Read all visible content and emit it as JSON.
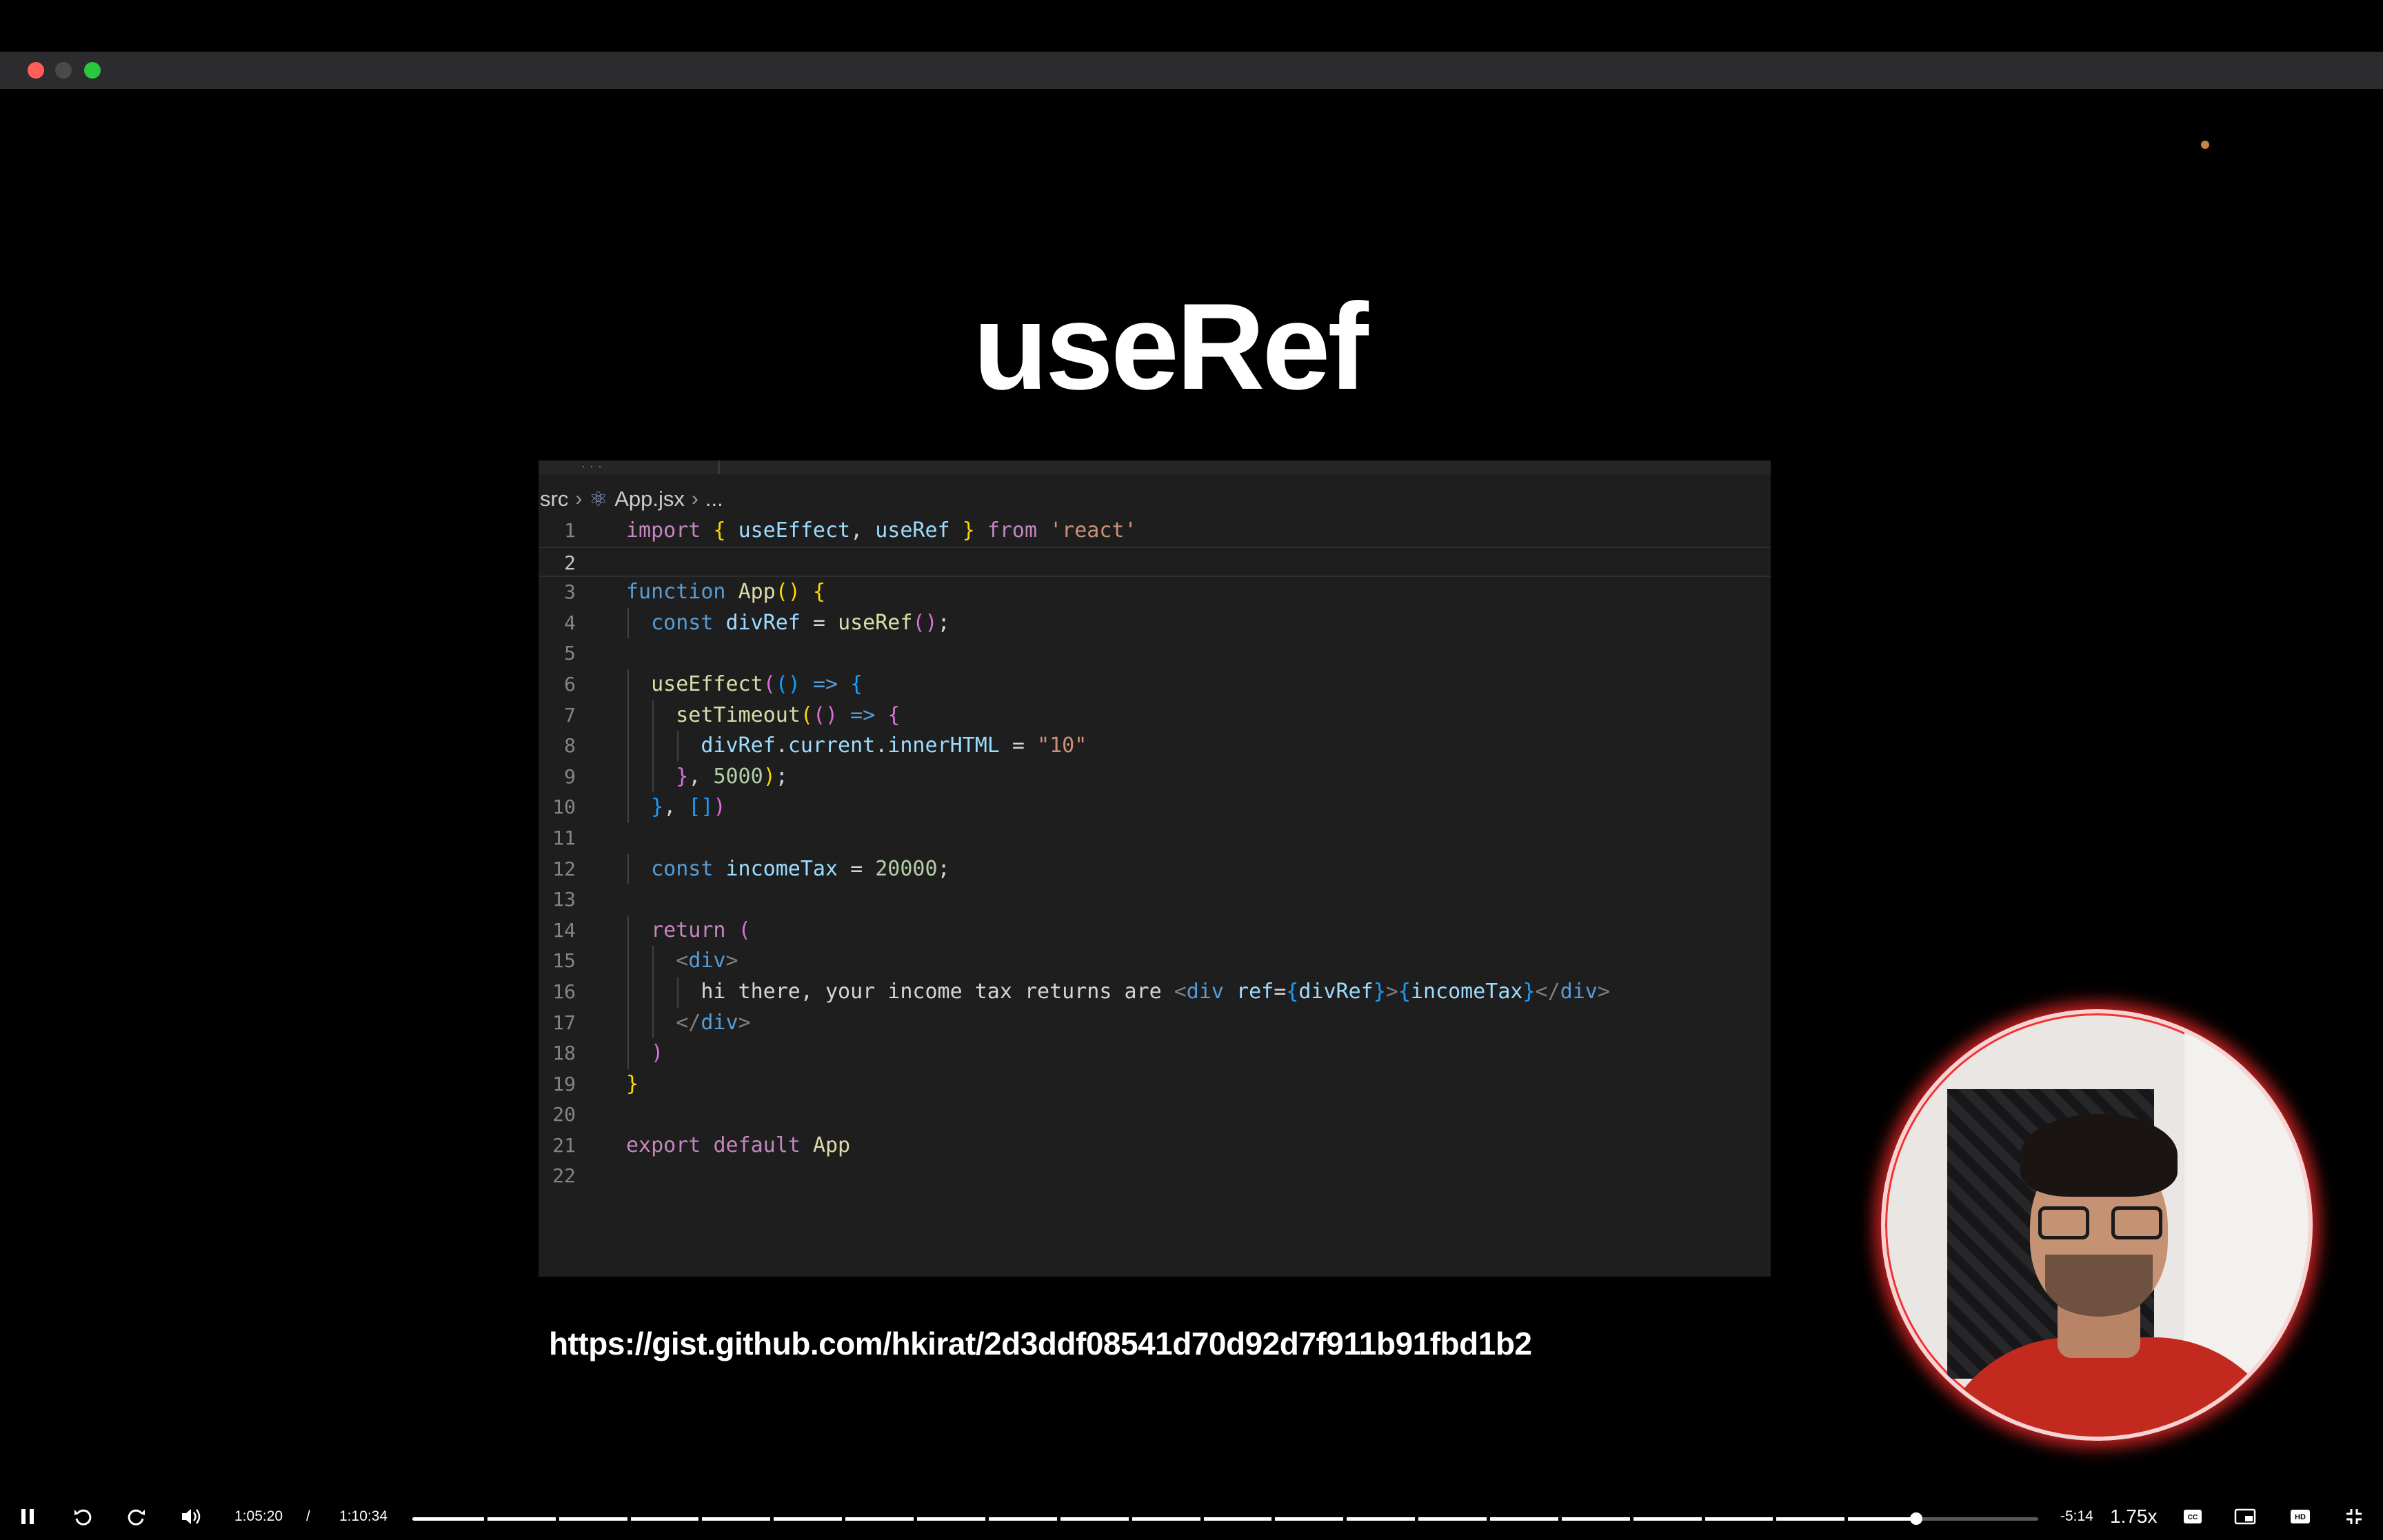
{
  "window": {
    "traffic_lights": [
      "close",
      "minimize",
      "maximize"
    ],
    "colors": {
      "close": "#ff5f57",
      "minimize": "#4a4a4a",
      "maximize": "#28c840"
    }
  },
  "slide": {
    "title": "useRef",
    "gist_url": "https://gist.github.com/hkirat/2d3ddf08541d70d92d7f911b91fbd1b2"
  },
  "editor": {
    "breadcrumb": {
      "folder": "src",
      "file": "App.jsx",
      "more": "..."
    },
    "active_line": 2,
    "lines": [
      {
        "n": "1",
        "tokens": [
          [
            "kw",
            "import"
          ],
          [
            "pl",
            " "
          ],
          [
            "by",
            "{"
          ],
          [
            "pl",
            " "
          ],
          [
            "vr",
            "useEffect"
          ],
          [
            "pl",
            ", "
          ],
          [
            "vr",
            "useRef"
          ],
          [
            "pl",
            " "
          ],
          [
            "by",
            "}"
          ],
          [
            "pl",
            " "
          ],
          [
            "kw",
            "from"
          ],
          [
            "pl",
            " "
          ],
          [
            "st",
            "'react'"
          ]
        ]
      },
      {
        "n": "2",
        "tokens": []
      },
      {
        "n": "3",
        "tokens": [
          [
            "kb",
            "function"
          ],
          [
            "pl",
            " "
          ],
          [
            "fn",
            "App"
          ],
          [
            "by",
            "()"
          ],
          [
            "pl",
            " "
          ],
          [
            "by",
            "{"
          ]
        ]
      },
      {
        "n": "4",
        "tokens": [
          [
            "pl",
            "  "
          ],
          [
            "kb",
            "const"
          ],
          [
            "pl",
            " "
          ],
          [
            "vr",
            "divRef"
          ],
          [
            "pl",
            " = "
          ],
          [
            "fn",
            "useRef"
          ],
          [
            "bp",
            "()"
          ],
          [
            "pl",
            ";"
          ]
        ]
      },
      {
        "n": "5",
        "tokens": []
      },
      {
        "n": "6",
        "tokens": [
          [
            "pl",
            "  "
          ],
          [
            "fn",
            "useEffect"
          ],
          [
            "bp",
            "("
          ],
          [
            "bb",
            "()"
          ],
          [
            "pl",
            " "
          ],
          [
            "kb",
            "=>"
          ],
          [
            "pl",
            " "
          ],
          [
            "bb",
            "{"
          ]
        ]
      },
      {
        "n": "7",
        "tokens": [
          [
            "pl",
            "    "
          ],
          [
            "fn",
            "setTimeout"
          ],
          [
            "by",
            "("
          ],
          [
            "bp",
            "()"
          ],
          [
            "pl",
            " "
          ],
          [
            "kb",
            "=>"
          ],
          [
            "pl",
            " "
          ],
          [
            "bp",
            "{"
          ]
        ]
      },
      {
        "n": "8",
        "tokens": [
          [
            "pl",
            "      "
          ],
          [
            "vr",
            "divRef"
          ],
          [
            "pl",
            "."
          ],
          [
            "vr",
            "current"
          ],
          [
            "pl",
            "."
          ],
          [
            "vr",
            "innerHTML"
          ],
          [
            "pl",
            " = "
          ],
          [
            "st",
            "\"10\""
          ]
        ]
      },
      {
        "n": "9",
        "tokens": [
          [
            "pl",
            "    "
          ],
          [
            "bp",
            "}"
          ],
          [
            "pl",
            ", "
          ],
          [
            "nm",
            "5000"
          ],
          [
            "by",
            ")"
          ],
          [
            "pl",
            ";"
          ]
        ]
      },
      {
        "n": "10",
        "tokens": [
          [
            "pl",
            "  "
          ],
          [
            "bb",
            "}"
          ],
          [
            "pl",
            ", "
          ],
          [
            "bb",
            "[]"
          ],
          [
            "bp",
            ")"
          ]
        ]
      },
      {
        "n": "11",
        "tokens": []
      },
      {
        "n": "12",
        "tokens": [
          [
            "pl",
            "  "
          ],
          [
            "kb",
            "const"
          ],
          [
            "pl",
            " "
          ],
          [
            "vr",
            "incomeTax"
          ],
          [
            "pl",
            " = "
          ],
          [
            "nm",
            "20000"
          ],
          [
            "pl",
            ";"
          ]
        ]
      },
      {
        "n": "13",
        "tokens": []
      },
      {
        "n": "14",
        "tokens": [
          [
            "pl",
            "  "
          ],
          [
            "kw",
            "return"
          ],
          [
            "pl",
            " "
          ],
          [
            "bp",
            "("
          ]
        ]
      },
      {
        "n": "15",
        "tokens": [
          [
            "pl",
            "    "
          ],
          [
            "tga",
            "<"
          ],
          [
            "tg",
            "div"
          ],
          [
            "tga",
            ">"
          ]
        ]
      },
      {
        "n": "16",
        "tokens": [
          [
            "pl",
            "      hi there, your income tax returns are "
          ],
          [
            "tga",
            "<"
          ],
          [
            "tg",
            "div"
          ],
          [
            "pl",
            " "
          ],
          [
            "vr",
            "ref"
          ],
          [
            "pl",
            "="
          ],
          [
            "bb",
            "{"
          ],
          [
            "vr",
            "divRef"
          ],
          [
            "bb",
            "}"
          ],
          [
            "tga",
            ">"
          ],
          [
            "bb",
            "{"
          ],
          [
            "vr",
            "incomeTax"
          ],
          [
            "bb",
            "}"
          ],
          [
            "tga",
            "</"
          ],
          [
            "tg",
            "div"
          ],
          [
            "tga",
            ">"
          ]
        ]
      },
      {
        "n": "17",
        "tokens": [
          [
            "pl",
            "    "
          ],
          [
            "tga",
            "</"
          ],
          [
            "tg",
            "div"
          ],
          [
            "tga",
            ">"
          ]
        ]
      },
      {
        "n": "18",
        "tokens": [
          [
            "pl",
            "  "
          ],
          [
            "bp",
            ")"
          ]
        ]
      },
      {
        "n": "19",
        "tokens": [
          [
            "by",
            "}"
          ]
        ]
      },
      {
        "n": "20",
        "tokens": []
      },
      {
        "n": "21",
        "tokens": [
          [
            "kw",
            "export"
          ],
          [
            "pl",
            " "
          ],
          [
            "kw",
            "default"
          ],
          [
            "pl",
            " "
          ],
          [
            "fn",
            "App"
          ]
        ]
      },
      {
        "n": "22",
        "tokens": []
      }
    ]
  },
  "player": {
    "current_time": "1:05:20",
    "separator": "/",
    "duration": "1:10:34",
    "remaining": "-5:14",
    "speed": "1.75x",
    "progress": 0.925,
    "icons": [
      "pause-icon",
      "rewind-10-icon",
      "forward-10-icon",
      "volume-icon",
      "captions-icon",
      "picture-in-picture-icon",
      "hd-icon",
      "exit-fullscreen-icon"
    ]
  }
}
